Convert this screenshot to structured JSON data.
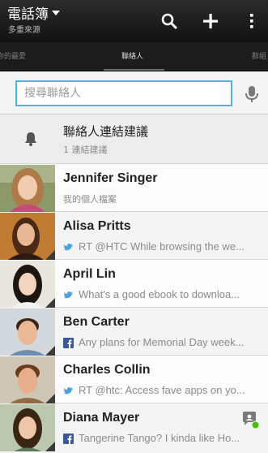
{
  "header": {
    "title": "電話簿",
    "subtitle": "多重來源",
    "icons": [
      "search-icon",
      "add-icon",
      "overflow-menu-icon"
    ]
  },
  "tabs": {
    "left": "你的最愛",
    "center": "聯絡人",
    "right": "群組"
  },
  "search": {
    "placeholder": "搜尋聯絡人",
    "value": ""
  },
  "suggestion": {
    "title": "聯絡人連結建議",
    "subtitle": "1 連結建議"
  },
  "contacts": [
    {
      "name": "Jennifer Singer",
      "status": "我的個人檔案",
      "service": ""
    },
    {
      "name": "Alisa Pritts",
      "status": "RT @HTC While browsing the we...",
      "service": "twitter"
    },
    {
      "name": "April Lin",
      "status": "What's a good ebook to downloa...",
      "service": "twitter"
    },
    {
      "name": "Ben Carter",
      "status": "Any plans for Memorial Day week...",
      "service": "facebook"
    },
    {
      "name": "Charles Collin",
      "status": "RT @htc: Access fave apps on yo...",
      "service": "twitter"
    },
    {
      "name": "Diana Mayer",
      "status": "Tangerine Tango? I kinda like Ho...",
      "service": "facebook",
      "online": true
    }
  ],
  "colors": {
    "accent": "#4fb3e3",
    "twitter": "#4aa3df",
    "facebook": "#3b5998",
    "online": "#4cbb17"
  }
}
